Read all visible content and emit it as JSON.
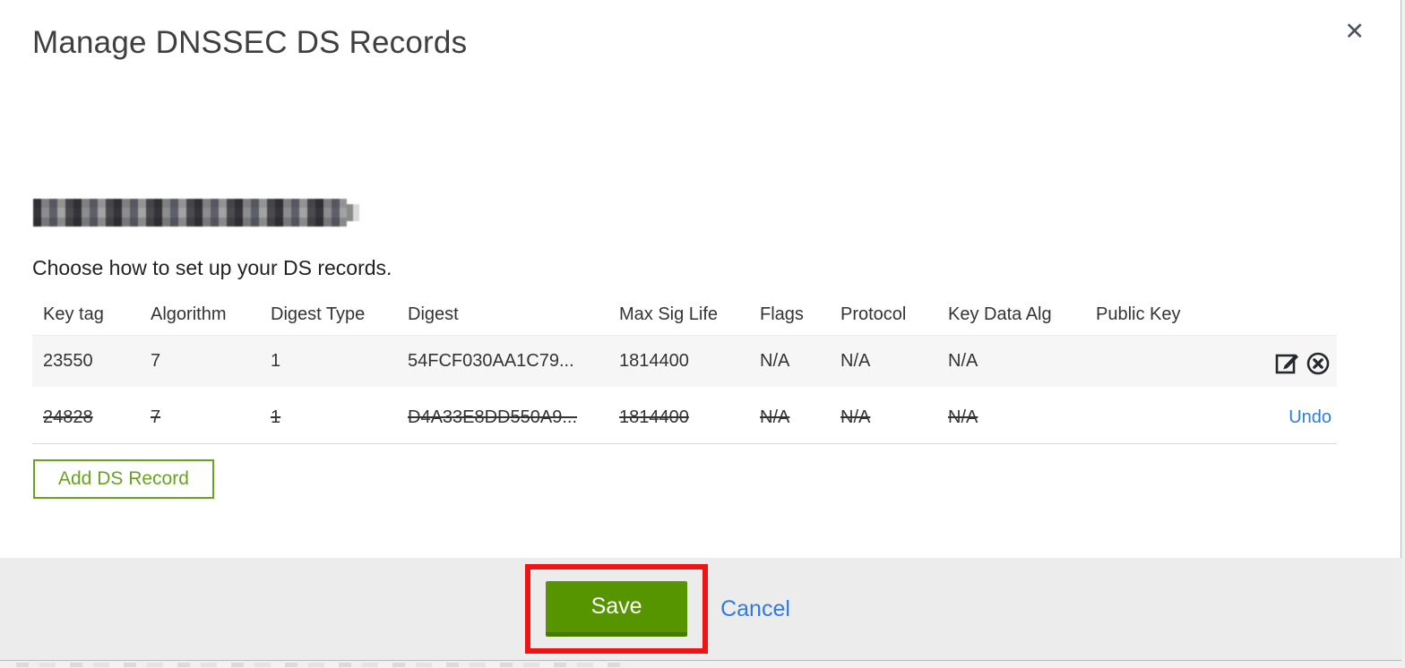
{
  "modal": {
    "title": "Manage DNSSEC DS Records",
    "instruction": "Choose how to set up your DS records.",
    "domain_redacted": true
  },
  "icons": {
    "close": "close-icon (✕)",
    "edit": "edit-pencil-square-icon",
    "delete": "delete-circle-x-icon"
  },
  "table": {
    "columns": [
      "Key tag",
      "Algorithm",
      "Digest Type",
      "Digest",
      "Max Sig Life",
      "Flags",
      "Protocol",
      "Key Data Alg",
      "Public Key"
    ],
    "rows": [
      {
        "key_tag": "23550",
        "algorithm": "7",
        "digest_type": "1",
        "digest": "54FCF030AA1C79...",
        "max_sig_life": "1814400",
        "flags": "N/A",
        "protocol": "N/A",
        "key_data_alg": "N/A",
        "public_key": "",
        "state": "normal"
      },
      {
        "key_tag": "24828",
        "algorithm": "7",
        "digest_type": "1",
        "digest": "D4A33E8DD550A9...",
        "max_sig_life": "1814400",
        "flags": "N/A",
        "protocol": "N/A",
        "key_data_alg": "N/A",
        "public_key": "",
        "state": "marked-for-deletion",
        "undo_label": "Undo"
      }
    ]
  },
  "buttons": {
    "add_ds_record": "Add DS Record",
    "save": "Save",
    "cancel": "Cancel",
    "close": "✕"
  },
  "colors": {
    "action_green": "#579500",
    "outline_green": "#6aa21f",
    "link_blue": "#2e7ce0",
    "annotation_red": "#ec1414",
    "footer_gray": "#ececec",
    "row_stripe_gray": "#f6f6f6"
  }
}
